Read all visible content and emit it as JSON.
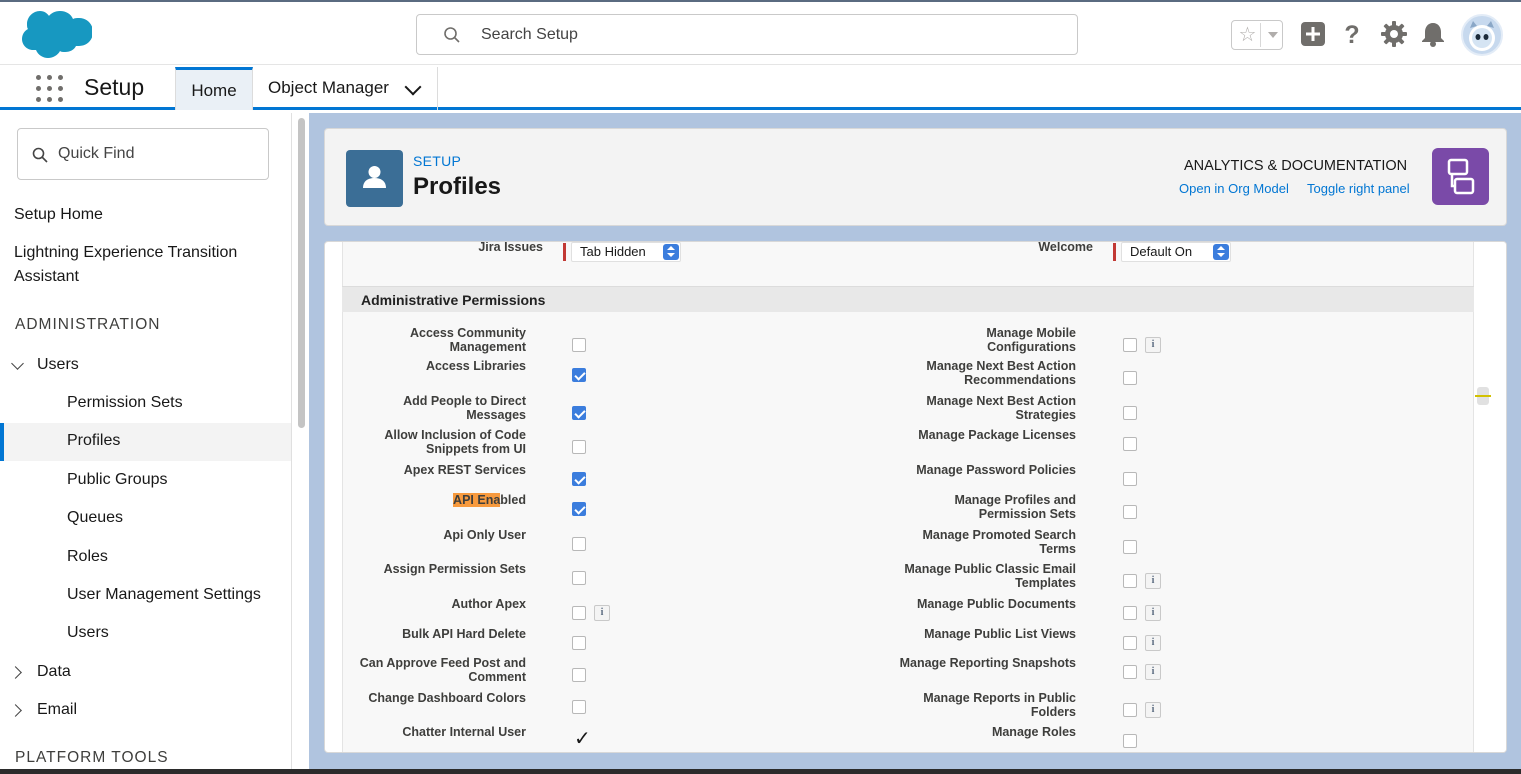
{
  "header": {
    "search_placeholder": "Search Setup",
    "icons": [
      "salesforce-cloud-logo",
      "search-icon",
      "star-icon",
      "plus-icon",
      "help-icon",
      "gear-icon",
      "bell-icon",
      "avatar"
    ]
  },
  "nav": {
    "app_name": "Setup",
    "tabs": [
      {
        "label": "Home",
        "active": true
      },
      {
        "label": "Object Manager",
        "active": false
      }
    ]
  },
  "sidebar": {
    "quickfind_placeholder": "Quick Find",
    "setup_home": "Setup Home",
    "lightning_line1": "Lightning Experience Transition",
    "lightning_line2": "Assistant",
    "administration": "ADMINISTRATION",
    "users_group": "Users",
    "users_children": [
      "Permission Sets",
      "Profiles",
      "Public Groups",
      "Queues",
      "Roles",
      "User Management Settings",
      "Users"
    ],
    "active_item": "Profiles",
    "data": "Data",
    "email": "Email",
    "platform_tools": "PLATFORM TOOLS"
  },
  "page_header": {
    "eyebrow": "SETUP",
    "title": "Profiles",
    "analytics": "ANALYTICS & DOCUMENTATION",
    "link_org_model": "Open in Org Model",
    "link_toggle": "Toggle right panel"
  },
  "tab_settings": {
    "left_label": "Jira Issues",
    "left_value": "Tab Hidden",
    "right_label": "Welcome",
    "right_value": "Default On"
  },
  "section_title": "Administrative Permissions",
  "permissions": {
    "left": [
      {
        "line1": "Access Community",
        "line2": "Management",
        "checked": false,
        "info": false
      },
      {
        "line1": "Access Libraries",
        "line2": "",
        "checked": true,
        "info": false
      },
      {
        "line1": "Add People to Direct",
        "line2": "Messages",
        "checked": true,
        "info": false
      },
      {
        "line1": "Allow Inclusion of Code",
        "line2": "Snippets from UI",
        "checked": false,
        "info": false
      },
      {
        "line1": "Apex REST Services",
        "line2": "",
        "checked": true,
        "info": false
      },
      {
        "line1": "API Enabled",
        "line2": "",
        "checked": true,
        "info": false,
        "highlight": "API Ena"
      },
      {
        "line1": "Api Only User",
        "line2": "",
        "checked": false,
        "info": false
      },
      {
        "line1": "Assign Permission Sets",
        "line2": "",
        "checked": false,
        "info": false
      },
      {
        "line1": "Author Apex",
        "line2": "",
        "checked": false,
        "info": true
      },
      {
        "line1": "Bulk API Hard Delete",
        "line2": "",
        "checked": false,
        "info": false
      },
      {
        "line1": "Can Approve Feed Post and",
        "line2": "Comment",
        "checked": false,
        "info": false
      },
      {
        "line1": "Change Dashboard Colors",
        "line2": "",
        "checked": false,
        "info": false
      },
      {
        "line1": "Chatter Internal User",
        "line2": "",
        "checked": "mark",
        "info": false
      }
    ],
    "right": [
      {
        "line1": "Manage Mobile",
        "line2": "Configurations",
        "checked": false,
        "info": true
      },
      {
        "line1": "Manage Next Best Action",
        "line2": "Recommendations",
        "checked": false,
        "info": false
      },
      {
        "line1": "Manage Next Best Action",
        "line2": "Strategies",
        "checked": false,
        "info": false
      },
      {
        "line1": "Manage Package Licenses",
        "line2": "",
        "checked": false,
        "info": false
      },
      {
        "line1": "Manage Password Policies",
        "line2": "",
        "checked": false,
        "info": false
      },
      {
        "line1": "Manage Profiles and",
        "line2": "Permission Sets",
        "checked": false,
        "info": false
      },
      {
        "line1": "Manage Promoted Search",
        "line2": "Terms",
        "checked": false,
        "info": false
      },
      {
        "line1": "Manage Public Classic Email",
        "line2": "Templates",
        "checked": false,
        "info": true
      },
      {
        "line1": "Manage Public Documents",
        "line2": "",
        "checked": false,
        "info": true
      },
      {
        "line1": "Manage Public List Views",
        "line2": "",
        "checked": false,
        "info": true
      },
      {
        "line1": "Manage Reporting Snapshots",
        "line2": "",
        "checked": false,
        "info": true
      },
      {
        "line1": "Manage Reports in Public",
        "line2": "Folders",
        "checked": false,
        "info": true
      },
      {
        "line1": "Manage Roles",
        "line2": "",
        "checked": false,
        "info": false
      }
    ]
  },
  "info_glyph": "i",
  "checkmark_glyph": "✓"
}
